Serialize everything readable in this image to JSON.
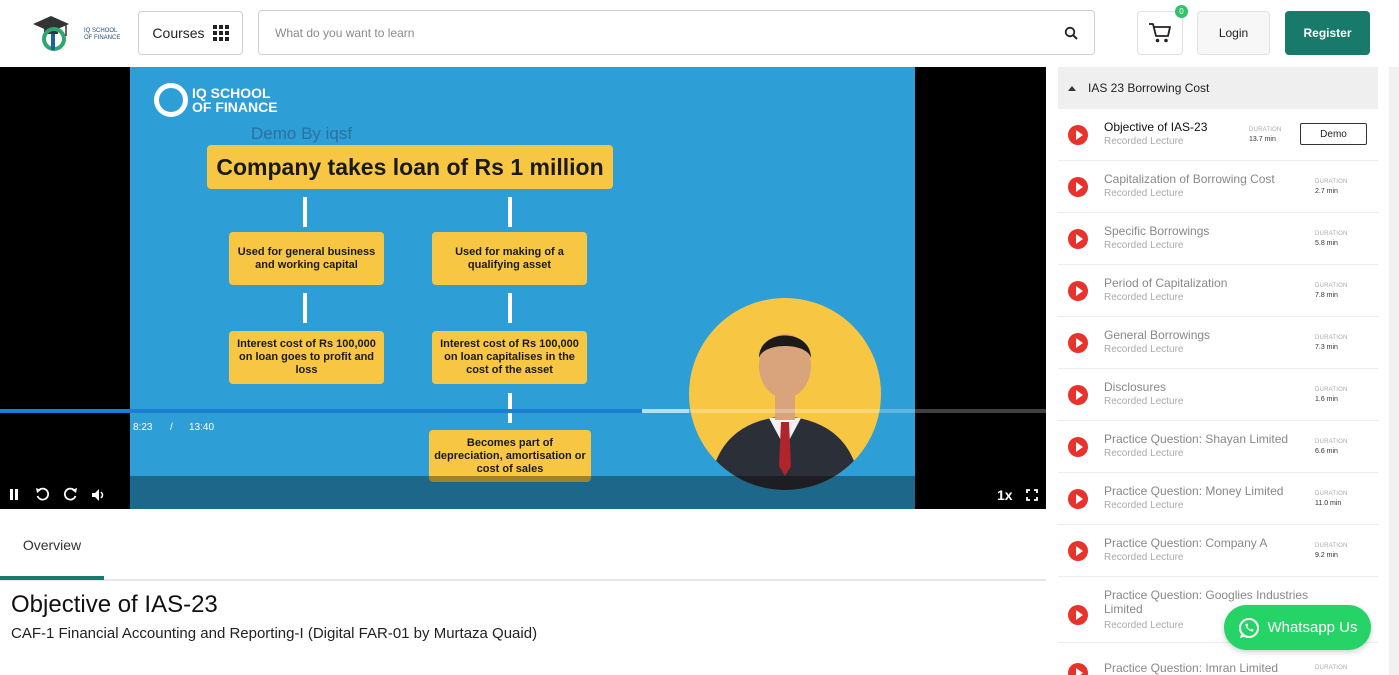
{
  "header": {
    "logo_text": "IQ SCHOOL OF FINANCE",
    "courses_label": "Courses",
    "search_placeholder": "What do you want to learn",
    "cart_count": "0",
    "login_label": "Login",
    "register_label": "Register"
  },
  "player": {
    "slide": {
      "logo_text": "IQ SCHOOL OF FINANCE",
      "watermark": "Demo By iqsf",
      "main_box": "Company takes loan of Rs 1 million",
      "left_box_1": "Used for general business and working capital",
      "right_box_1": "Used for making of a qualifying asset",
      "left_box_2": "Interest cost of Rs 100,000 on loan goes to profit and loss",
      "right_box_2": "Interest cost of Rs 100,000 on loan capitalises in the cost of the asset",
      "right_box_3": "Becomes part of depreciation, amortisation or cost of sales"
    },
    "current_time": "8:23",
    "separator": "/",
    "total_time": "13:40",
    "progress": 0.614,
    "speed": "1x"
  },
  "tabs": {
    "overview": "Overview"
  },
  "lecture": {
    "title": "Objective of IAS-23",
    "course": "CAF-1 Financial Accounting and Reporting-I (Digital FAR-01 by Murtaza Quaid)"
  },
  "sidebar": {
    "section_title": "IAS 23 Borrowing Cost",
    "duration_label": "DURATION",
    "demo_label": "Demo",
    "items": [
      {
        "name": "Objective of IAS-23",
        "type": "Recorded Lecture",
        "duration": "13.7 min"
      },
      {
        "name": "Capitalization of Borrowing Cost",
        "type": "Recorded Lecture",
        "duration": "2.7 min"
      },
      {
        "name": "Specific Borrowings",
        "type": "Recorded Lecture",
        "duration": "5.8 min"
      },
      {
        "name": "Period of Capitalization",
        "type": "Recorded Lecture",
        "duration": "7.8 min"
      },
      {
        "name": "General Borrowings",
        "type": "Recorded Lecture",
        "duration": "7.3 min"
      },
      {
        "name": "Disclosures",
        "type": "Recorded Lecture",
        "duration": "1.6 min"
      },
      {
        "name": "Practice Question: Shayan Limited",
        "type": "Recorded Lecture",
        "duration": "6.6 min"
      },
      {
        "name": "Practice Question: Money Limited",
        "type": "Recorded Lecture",
        "duration": "11.0 min"
      },
      {
        "name": "Practice Question: Company A",
        "type": "Recorded Lecture",
        "duration": "9.2 min"
      },
      {
        "name": "Practice Question: Googlies Industries Limited",
        "type": "Recorded Lecture",
        "duration": ""
      },
      {
        "name": "Practice Question: Imran Limited",
        "type": "",
        "duration": ""
      }
    ]
  },
  "whatsapp_label": "Whatsapp Us",
  "colors": {
    "brand_green": "#177a6b",
    "slide_blue": "#2d9ed6",
    "slide_yellow": "#f7c744",
    "play_red": "#e8322c",
    "whatsapp_green": "#25d366",
    "progress_blue": "#1a7fd4"
  }
}
